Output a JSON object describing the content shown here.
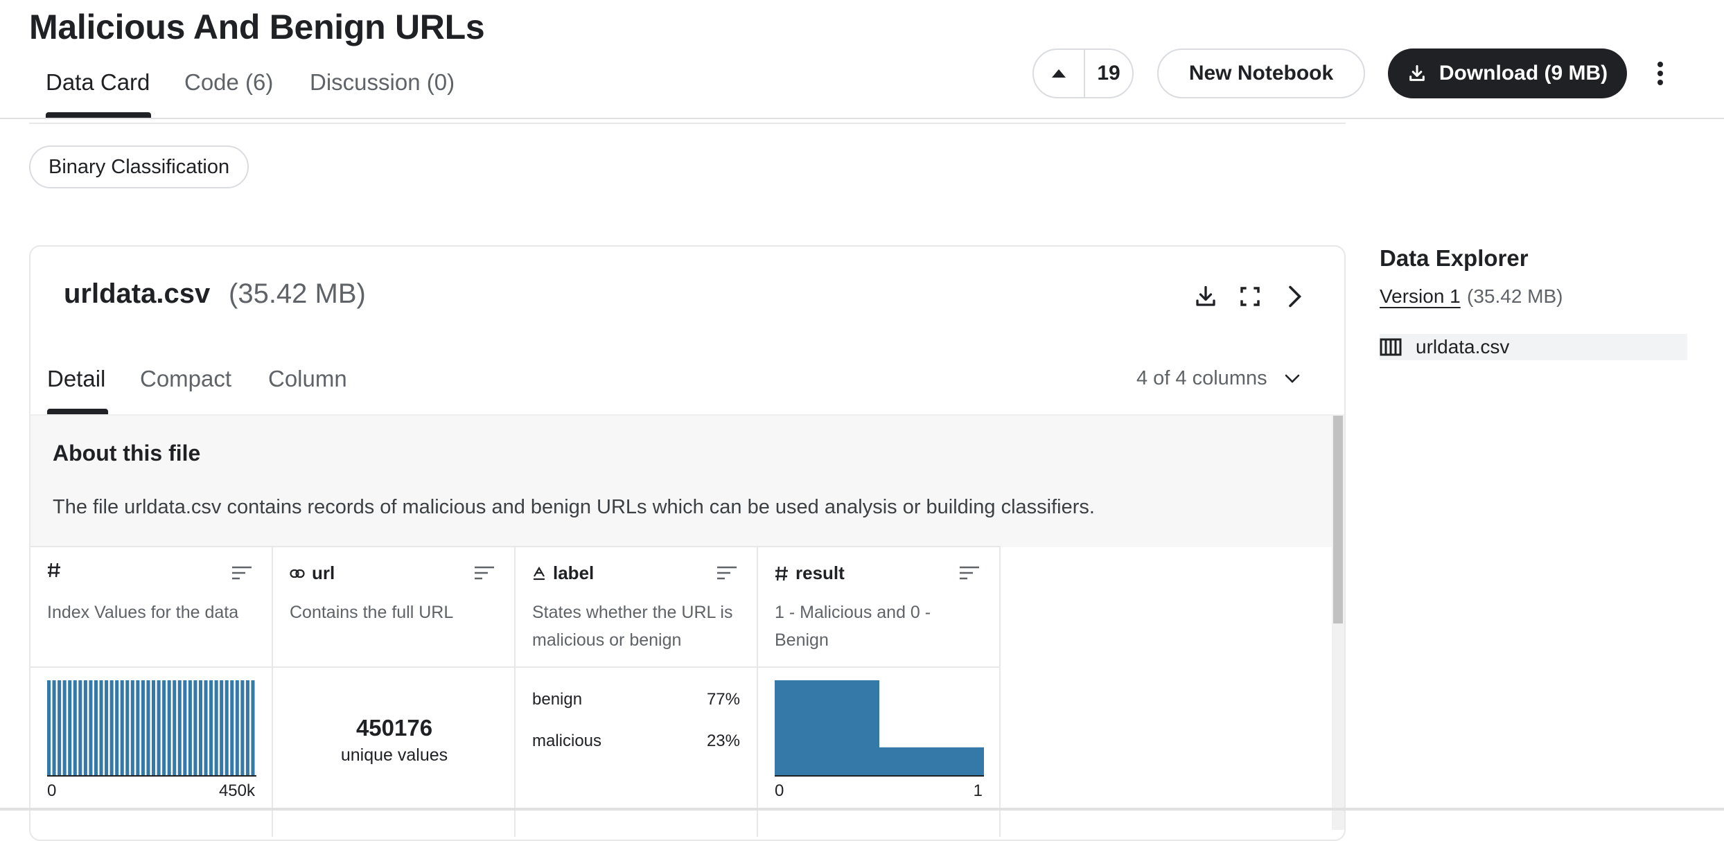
{
  "page": {
    "title": "Malicious And Benign URLs"
  },
  "tabs": [
    {
      "label": "Data Card",
      "active": true
    },
    {
      "label": "Code (6)",
      "active": false
    },
    {
      "label": "Discussion (0)",
      "active": false
    }
  ],
  "actions": {
    "vote_count": "19",
    "new_notebook_label": "New Notebook",
    "download_label": "Download (9 MB)"
  },
  "tags": [
    "Binary Classification"
  ],
  "file": {
    "name": "urldata.csv",
    "size": "(35.42 MB)",
    "view_tabs": [
      {
        "label": "Detail",
        "active": true
      },
      {
        "label": "Compact",
        "active": false
      },
      {
        "label": "Column",
        "active": false
      }
    ],
    "columns_selector": "4 of 4 columns",
    "about_title": "About this file",
    "about_text": "The file urldata.csv contains records of malicious and benign URLs which can be used analysis or building classifiers."
  },
  "columns": [
    {
      "name": "",
      "type_icon": "hash-icon",
      "description": "Index Values for the data",
      "summary": {
        "type": "histogram",
        "min_label": "0",
        "max_label": "450k"
      }
    },
    {
      "name": "url",
      "type_icon": "link-icon",
      "description": "Contains the full URL",
      "summary": {
        "type": "unique",
        "value": "450176",
        "caption": "unique values"
      }
    },
    {
      "name": "label",
      "type_icon": "text-icon",
      "description": "States whether the URL is malicious or benign",
      "summary": {
        "type": "categories",
        "items": [
          {
            "label": "benign",
            "pct": "77%"
          },
          {
            "label": "malicious",
            "pct": "23%"
          }
        ]
      }
    },
    {
      "name": "result",
      "type_icon": "hash-icon",
      "description": "1 - Malicious and 0 - Benign",
      "summary": {
        "type": "histogram",
        "min_label": "0",
        "max_label": "1"
      }
    }
  ],
  "chart_data": [
    {
      "type": "bar",
      "title": "",
      "categories": [
        "0",
        "1"
      ],
      "values": [
        77,
        23
      ],
      "xlabel": "",
      "ylabel": "",
      "tick_labels": [
        "0",
        "1"
      ]
    },
    {
      "type": "bar",
      "title": "",
      "note_values": "uniform index distribution",
      "bins": 40,
      "values": [
        1,
        1,
        1,
        1,
        1,
        1,
        1,
        1,
        1,
        1,
        1,
        1,
        1,
        1,
        1,
        1,
        1,
        1,
        1,
        1,
        1,
        1,
        1,
        1,
        1,
        1,
        1,
        1,
        1,
        1,
        1,
        1,
        1,
        1,
        1,
        1,
        1,
        1,
        1,
        1
      ],
      "tick_labels": [
        "0",
        "450k"
      ]
    }
  ],
  "explorer": {
    "title": "Data Explorer",
    "version_label": "Version 1",
    "version_size": "(35.42 MB)",
    "files": [
      "urldata.csv"
    ]
  },
  "colors": {
    "bar": "#3579a8",
    "dark": "#202124",
    "muted": "#5f6368"
  }
}
